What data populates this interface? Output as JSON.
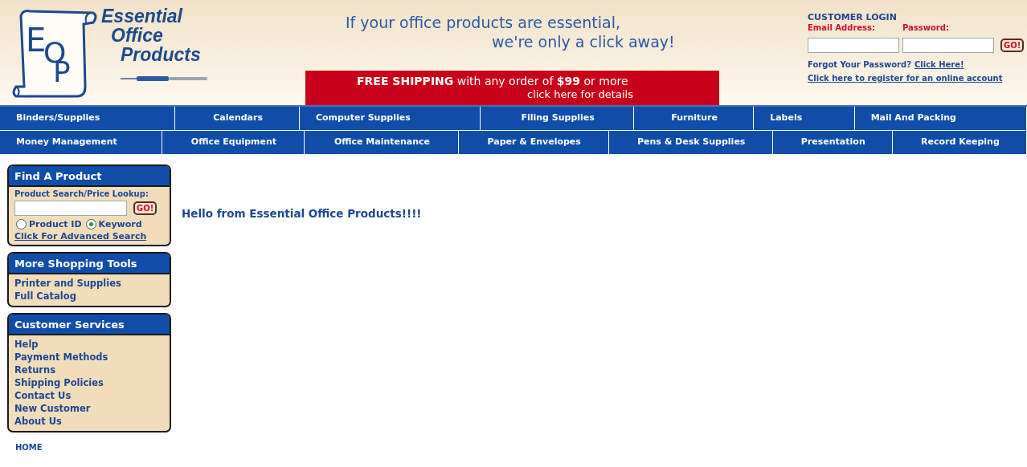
{
  "logo": {
    "monogram": [
      "E",
      "O",
      "P"
    ],
    "lines": [
      "Essential",
      "Office",
      "Products"
    ]
  },
  "tagline": [
    "If your office products are essential,",
    "we're only a click away!"
  ],
  "promo": {
    "text": "**FREE SHIPPING** with any order of **$99** or more",
    "details": "click here for details"
  },
  "login": {
    "title": "CUSTOMER LOGIN",
    "email_label": "Email Address:",
    "password_label": "Password:",
    "button": "GO!",
    "forgot": "Forgot Your Password?",
    "forgot_link": "Click Here!",
    "register": "Click here to register for an online account"
  },
  "nav_rows": [
    [
      "Binders/Supplies",
      "Calendars",
      "Computer Supplies",
      "Filing Supplies",
      "Furniture",
      "Labels",
      "Mail And Packing"
    ],
    [
      "Money Management",
      "Office Equipment",
      "Office Maintenance",
      "Paper & Envelopes",
      "Pens & Desk Supplies",
      "Presentation",
      "Record Keeping"
    ]
  ],
  "find_product": {
    "title": "Find A Product",
    "label": "Product Search/Price Lookup:",
    "button": "GO!",
    "options": [
      {
        "label": "Product ID",
        "selected": false
      },
      {
        "label": "Keyword",
        "selected": true
      }
    ],
    "advanced": "Click For Advanced Search"
  },
  "panels": [
    {
      "title": "More Shopping Tools",
      "links": [
        "Printer and Supplies",
        "Full Catalog"
      ]
    },
    {
      "title": "Customer Services",
      "links": [
        "Help",
        "Payment Methods",
        "Returns",
        "Shipping Policies",
        "Contact Us",
        "New Customer",
        "About Us"
      ]
    }
  ],
  "greeting": "Hello from Essential Office Products!!!!",
  "footer_link": "HOME"
}
